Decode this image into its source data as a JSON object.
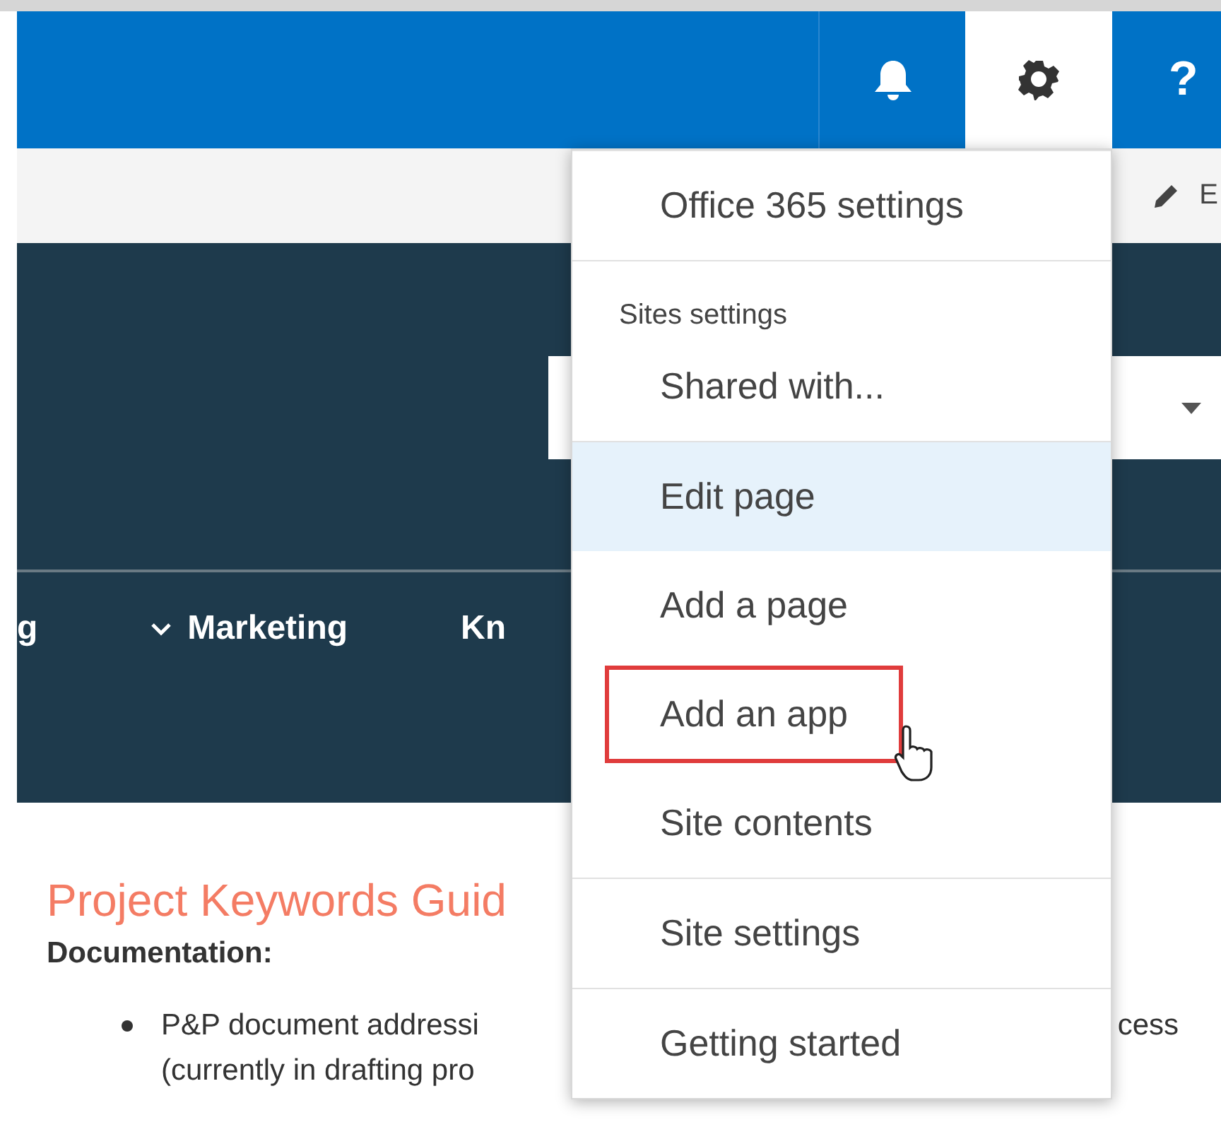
{
  "header_buttons": [
    {
      "kind": "bell",
      "selected": false
    },
    {
      "kind": "gear",
      "selected": true
    },
    {
      "kind": "help",
      "glyph": "?",
      "selected": false
    }
  ],
  "command_bar": {
    "edit_label": "E"
  },
  "nav": {
    "items": [
      {
        "label": "g",
        "has_caret": false
      },
      {
        "label": "Marketing",
        "has_caret": true
      },
      {
        "label": "Kn",
        "has_caret": false
      }
    ]
  },
  "content": {
    "title": "Project Keywords Guid",
    "heading": "Documentation:",
    "bullet": {
      "lines": [
        {
          "left": "P&P document addressi",
          "right": "cess"
        },
        {
          "left": "(currently in drafting pro"
        }
      ]
    }
  },
  "settings_menu": {
    "sections": [
      {
        "items": [
          {
            "label": "Office 365 settings",
            "hovered": false,
            "outlined": false
          }
        ]
      },
      {
        "header": "Sites settings",
        "items": [
          {
            "label": "Shared with...",
            "hovered": false,
            "outlined": false
          }
        ]
      },
      {
        "items": [
          {
            "label": "Edit page",
            "hovered": true,
            "outlined": false
          },
          {
            "label": "Add a page",
            "hovered": false,
            "outlined": false
          },
          {
            "label": "Add an app",
            "hovered": false,
            "outlined": true
          },
          {
            "label": "Site contents",
            "hovered": false,
            "outlined": false
          }
        ]
      },
      {
        "items": [
          {
            "label": "Site settings",
            "hovered": false,
            "outlined": false
          }
        ]
      },
      {
        "items": [
          {
            "label": "Getting started",
            "hovered": false,
            "outlined": false
          }
        ]
      }
    ]
  }
}
